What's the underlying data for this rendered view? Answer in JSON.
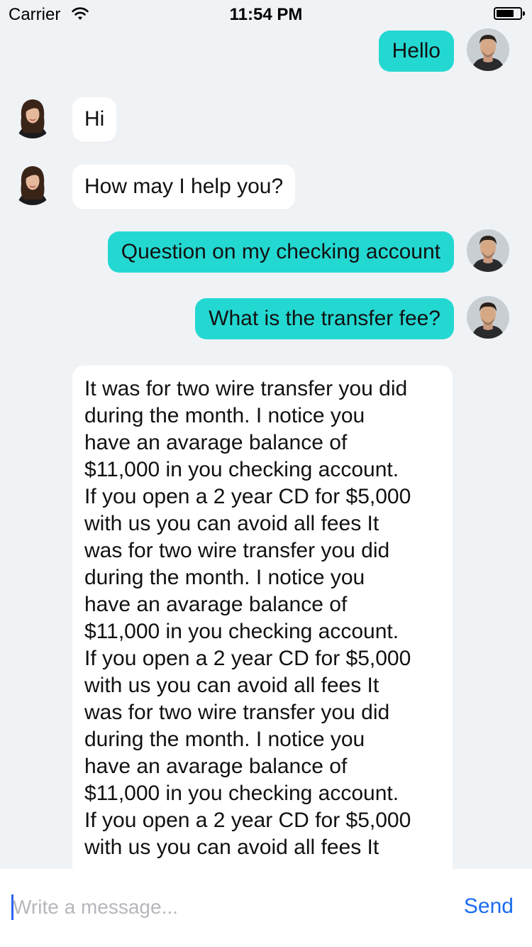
{
  "status_bar": {
    "carrier": "Carrier",
    "time": "11:54 PM"
  },
  "messages": [
    {
      "sender": "user",
      "text": "Hello"
    },
    {
      "sender": "agent",
      "text": "Hi"
    },
    {
      "sender": "agent",
      "text": "How may I help you?"
    },
    {
      "sender": "user",
      "text": "Question on my checking account"
    },
    {
      "sender": "user",
      "text": "What is the transfer fee?"
    },
    {
      "sender": "agent",
      "lines": [
        "It was for two wire transfer you did",
        "during the month. I notice you",
        "have an avarage balance of",
        "$11,000 in you checking account.",
        "If you open a 2 year CD for $5,000",
        "with us you can avoid all fees It",
        "was for two wire transfer you did",
        "during the month. I notice you",
        "have an avarage balance of",
        "$11,000 in you checking account.",
        "If you open a 2 year CD for $5,000",
        "with us you can avoid all fees It",
        "was for two wire transfer you did",
        "during the month. I notice you",
        "have an avarage balance of",
        "$11,000 in you checking account.",
        "If you open a 2 year CD for $5,000",
        "with us you can avoid all fees It"
      ]
    }
  ],
  "composer": {
    "placeholder": "Write a message...",
    "value": "",
    "send_label": "Send"
  },
  "colors": {
    "outgoing_bubble": "#24d8d2",
    "incoming_bubble": "#ffffff",
    "background": "#f0f3f6",
    "send_accent": "#1a6cf0"
  },
  "icons": {
    "wifi": "wifi-icon",
    "battery": "battery-icon",
    "user_avatar": "user-avatar",
    "agent_avatar": "agent-avatar"
  }
}
